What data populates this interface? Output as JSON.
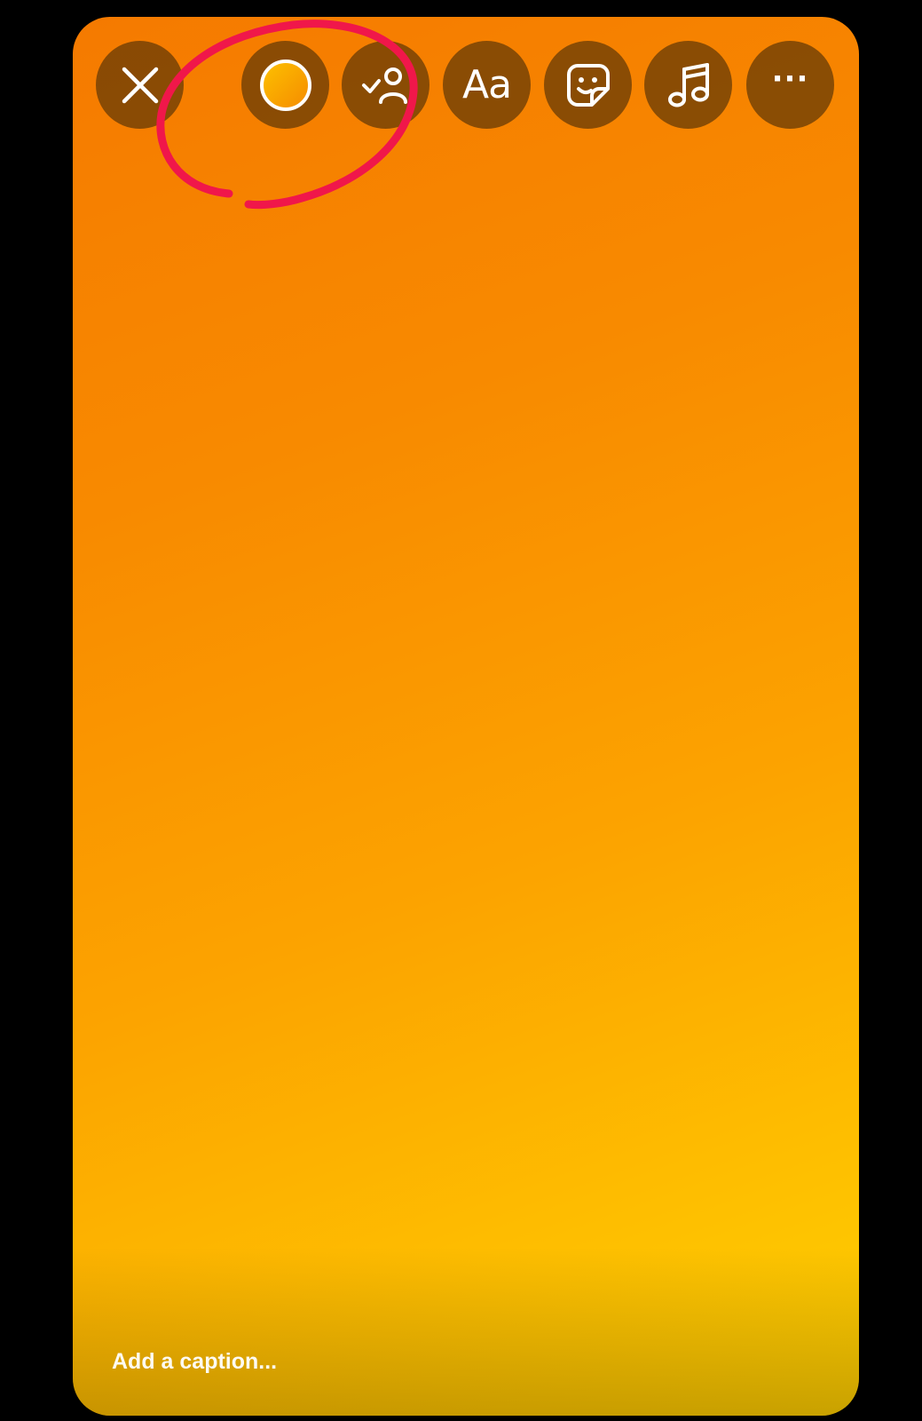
{
  "toolbar": {
    "close": {
      "icon": "close-icon"
    },
    "color": {
      "icon": "color-circle-icon",
      "swatch_color": "#fb9a00"
    },
    "tag_people": {
      "icon": "tag-people-icon"
    },
    "text": {
      "label": "Aa"
    },
    "sticker": {
      "icon": "sticker-icon"
    },
    "music": {
      "icon": "music-note-icon"
    },
    "more": {
      "label": "···"
    }
  },
  "annotation": {
    "color": "#f0174a",
    "target": "color-button"
  },
  "caption": {
    "placeholder": "Add a caption..."
  },
  "colors": {
    "background_top": "#f57a00",
    "background_bottom": "#ffd100",
    "button_fill": "#5f3705"
  }
}
